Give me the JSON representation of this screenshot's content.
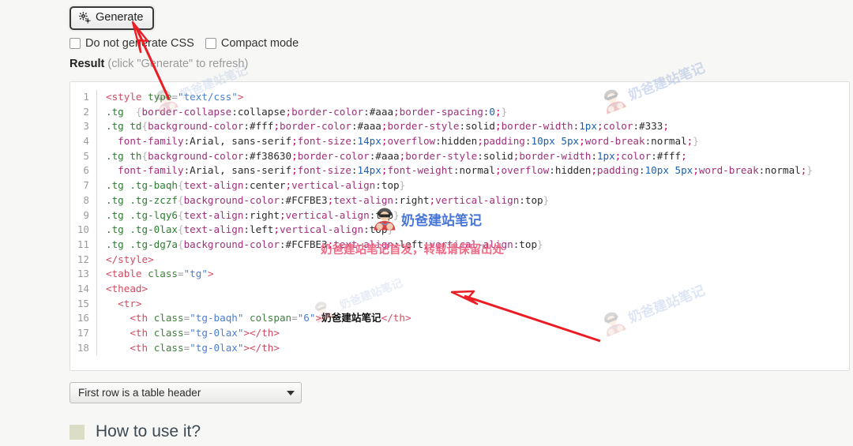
{
  "toolbar": {
    "generate_label": "Generate",
    "generate_icon": "gear-icon"
  },
  "options": {
    "no_css_label": "Do not generate CSS",
    "no_css_checked": false,
    "compact_label": "Compact mode",
    "compact_checked": false
  },
  "result": {
    "label": "Result",
    "hint": "(click \"Generate\" to refresh)"
  },
  "select": {
    "value": "First row is a table header",
    "caret_icon": "chevron-down-icon"
  },
  "howto": {
    "title": "How to use it?"
  },
  "code": {
    "lines": [
      {
        "n": "1",
        "tokens": [
          {
            "c": "t-tag",
            "s": "<style "
          },
          {
            "c": "t-attr",
            "s": "type"
          },
          {
            "c": "t-punct",
            "s": "="
          },
          {
            "c": "t-str",
            "s": "\"text/css\""
          },
          {
            "c": "t-tag",
            "s": ">"
          }
        ]
      },
      {
        "n": "2",
        "tokens": [
          {
            "c": "t-sel",
            "s": ".tg  "
          },
          {
            "c": "t-brace",
            "s": "{"
          },
          {
            "c": "t-prop",
            "s": "border-collapse"
          },
          {
            "c": "t-plain",
            "s": ":"
          },
          {
            "c": "t-val",
            "s": "collapse"
          },
          {
            "c": "t-semi",
            "s": ";"
          },
          {
            "c": "t-prop",
            "s": "border-color"
          },
          {
            "c": "t-plain",
            "s": ":"
          },
          {
            "c": "t-val",
            "s": "#aaa"
          },
          {
            "c": "t-semi",
            "s": ";"
          },
          {
            "c": "t-prop",
            "s": "border-spacing"
          },
          {
            "c": "t-plain",
            "s": ":"
          },
          {
            "c": "t-num",
            "s": "0"
          },
          {
            "c": "t-semi",
            "s": ";"
          },
          {
            "c": "t-brace",
            "s": "}"
          }
        ]
      },
      {
        "n": "3",
        "tokens": [
          {
            "c": "t-sel",
            "s": ".tg td"
          },
          {
            "c": "t-brace",
            "s": "{"
          },
          {
            "c": "t-prop",
            "s": "background-color"
          },
          {
            "c": "t-plain",
            "s": ":"
          },
          {
            "c": "t-val",
            "s": "#fff"
          },
          {
            "c": "t-semi",
            "s": ";"
          },
          {
            "c": "t-prop",
            "s": "border-color"
          },
          {
            "c": "t-plain",
            "s": ":"
          },
          {
            "c": "t-val",
            "s": "#aaa"
          },
          {
            "c": "t-semi",
            "s": ";"
          },
          {
            "c": "t-prop",
            "s": "border-style"
          },
          {
            "c": "t-plain",
            "s": ":"
          },
          {
            "c": "t-val",
            "s": "solid"
          },
          {
            "c": "t-semi",
            "s": ";"
          },
          {
            "c": "t-prop",
            "s": "border-width"
          },
          {
            "c": "t-plain",
            "s": ":"
          },
          {
            "c": "t-num",
            "s": "1px"
          },
          {
            "c": "t-semi",
            "s": ";"
          },
          {
            "c": "t-prop",
            "s": "color"
          },
          {
            "c": "t-plain",
            "s": ":"
          },
          {
            "c": "t-val",
            "s": "#333"
          },
          {
            "c": "t-semi",
            "s": ";"
          }
        ]
      },
      {
        "n": "4",
        "tokens": [
          {
            "c": "t-plain",
            "s": "  "
          },
          {
            "c": "t-prop",
            "s": "font-family"
          },
          {
            "c": "t-plain",
            "s": ":"
          },
          {
            "c": "t-val",
            "s": "Arial, sans-serif"
          },
          {
            "c": "t-semi",
            "s": ";"
          },
          {
            "c": "t-prop",
            "s": "font-size"
          },
          {
            "c": "t-plain",
            "s": ":"
          },
          {
            "c": "t-num",
            "s": "14px"
          },
          {
            "c": "t-semi",
            "s": ";"
          },
          {
            "c": "t-prop",
            "s": "overflow"
          },
          {
            "c": "t-plain",
            "s": ":"
          },
          {
            "c": "t-val",
            "s": "hidden"
          },
          {
            "c": "t-semi",
            "s": ";"
          },
          {
            "c": "t-prop",
            "s": "padding"
          },
          {
            "c": "t-plain",
            "s": ":"
          },
          {
            "c": "t-num",
            "s": "10px 5px"
          },
          {
            "c": "t-semi",
            "s": ";"
          },
          {
            "c": "t-prop",
            "s": "word-break"
          },
          {
            "c": "t-plain",
            "s": ":"
          },
          {
            "c": "t-val",
            "s": "normal"
          },
          {
            "c": "t-semi",
            "s": ";"
          },
          {
            "c": "t-brace",
            "s": "}"
          }
        ]
      },
      {
        "n": "5",
        "tokens": [
          {
            "c": "t-sel",
            "s": ".tg th"
          },
          {
            "c": "t-brace",
            "s": "{"
          },
          {
            "c": "t-prop",
            "s": "background-color"
          },
          {
            "c": "t-plain",
            "s": ":"
          },
          {
            "c": "t-val",
            "s": "#f38630"
          },
          {
            "c": "t-semi",
            "s": ";"
          },
          {
            "c": "t-prop",
            "s": "border-color"
          },
          {
            "c": "t-plain",
            "s": ":"
          },
          {
            "c": "t-val",
            "s": "#aaa"
          },
          {
            "c": "t-semi",
            "s": ";"
          },
          {
            "c": "t-prop",
            "s": "border-style"
          },
          {
            "c": "t-plain",
            "s": ":"
          },
          {
            "c": "t-val",
            "s": "solid"
          },
          {
            "c": "t-semi",
            "s": ";"
          },
          {
            "c": "t-prop",
            "s": "border-width"
          },
          {
            "c": "t-plain",
            "s": ":"
          },
          {
            "c": "t-num",
            "s": "1px"
          },
          {
            "c": "t-semi",
            "s": ";"
          },
          {
            "c": "t-prop",
            "s": "color"
          },
          {
            "c": "t-plain",
            "s": ":"
          },
          {
            "c": "t-val",
            "s": "#fff"
          },
          {
            "c": "t-semi",
            "s": ";"
          }
        ]
      },
      {
        "n": "6",
        "tokens": [
          {
            "c": "t-plain",
            "s": "  "
          },
          {
            "c": "t-prop",
            "s": "font-family"
          },
          {
            "c": "t-plain",
            "s": ":"
          },
          {
            "c": "t-val",
            "s": "Arial, sans-serif"
          },
          {
            "c": "t-semi",
            "s": ";"
          },
          {
            "c": "t-prop",
            "s": "font-size"
          },
          {
            "c": "t-plain",
            "s": ":"
          },
          {
            "c": "t-num",
            "s": "14px"
          },
          {
            "c": "t-semi",
            "s": ";"
          },
          {
            "c": "t-prop",
            "s": "font-weight"
          },
          {
            "c": "t-plain",
            "s": ":"
          },
          {
            "c": "t-val",
            "s": "normal"
          },
          {
            "c": "t-semi",
            "s": ";"
          },
          {
            "c": "t-prop",
            "s": "overflow"
          },
          {
            "c": "t-plain",
            "s": ":"
          },
          {
            "c": "t-val",
            "s": "hidden"
          },
          {
            "c": "t-semi",
            "s": ";"
          },
          {
            "c": "t-prop",
            "s": "padding"
          },
          {
            "c": "t-plain",
            "s": ":"
          },
          {
            "c": "t-num",
            "s": "10px 5px"
          },
          {
            "c": "t-semi",
            "s": ";"
          },
          {
            "c": "t-prop",
            "s": "word-break"
          },
          {
            "c": "t-plain",
            "s": ":"
          },
          {
            "c": "t-val",
            "s": "normal"
          },
          {
            "c": "t-semi",
            "s": ";"
          },
          {
            "c": "t-brace",
            "s": "}"
          }
        ]
      },
      {
        "n": "7",
        "tokens": [
          {
            "c": "t-sel",
            "s": ".tg .tg-baqh"
          },
          {
            "c": "t-brace",
            "s": "{"
          },
          {
            "c": "t-prop",
            "s": "text-align"
          },
          {
            "c": "t-plain",
            "s": ":"
          },
          {
            "c": "t-val",
            "s": "center"
          },
          {
            "c": "t-semi",
            "s": ";"
          },
          {
            "c": "t-prop",
            "s": "vertical-align"
          },
          {
            "c": "t-plain",
            "s": ":"
          },
          {
            "c": "t-val",
            "s": "top"
          },
          {
            "c": "t-brace",
            "s": "}"
          }
        ]
      },
      {
        "n": "8",
        "tokens": [
          {
            "c": "t-sel",
            "s": ".tg .tg-zczf"
          },
          {
            "c": "t-brace",
            "s": "{"
          },
          {
            "c": "t-prop",
            "s": "background-color"
          },
          {
            "c": "t-plain",
            "s": ":"
          },
          {
            "c": "t-val",
            "s": "#FCFBE3"
          },
          {
            "c": "t-semi",
            "s": ";"
          },
          {
            "c": "t-prop",
            "s": "text-align"
          },
          {
            "c": "t-plain",
            "s": ":"
          },
          {
            "c": "t-val",
            "s": "right"
          },
          {
            "c": "t-semi",
            "s": ";"
          },
          {
            "c": "t-prop",
            "s": "vertical-align"
          },
          {
            "c": "t-plain",
            "s": ":"
          },
          {
            "c": "t-val",
            "s": "top"
          },
          {
            "c": "t-brace",
            "s": "}"
          }
        ]
      },
      {
        "n": "9",
        "tokens": [
          {
            "c": "t-sel",
            "s": ".tg .tg-lqy6"
          },
          {
            "c": "t-brace",
            "s": "{"
          },
          {
            "c": "t-prop",
            "s": "text-align"
          },
          {
            "c": "t-plain",
            "s": ":"
          },
          {
            "c": "t-val",
            "s": "right"
          },
          {
            "c": "t-semi",
            "s": ";"
          },
          {
            "c": "t-prop",
            "s": "vertical-align"
          },
          {
            "c": "t-plain",
            "s": ":"
          },
          {
            "c": "t-val",
            "s": "top"
          },
          {
            "c": "t-brace",
            "s": "}"
          }
        ]
      },
      {
        "n": "10",
        "tokens": [
          {
            "c": "t-sel",
            "s": ".tg .tg-0lax"
          },
          {
            "c": "t-brace",
            "s": "{"
          },
          {
            "c": "t-prop",
            "s": "text-align"
          },
          {
            "c": "t-plain",
            "s": ":"
          },
          {
            "c": "t-val",
            "s": "left"
          },
          {
            "c": "t-semi",
            "s": ";"
          },
          {
            "c": "t-prop",
            "s": "vertical-align"
          },
          {
            "c": "t-plain",
            "s": ":"
          },
          {
            "c": "t-val",
            "s": "top"
          },
          {
            "c": "t-brace",
            "s": "}"
          }
        ]
      },
      {
        "n": "11",
        "tokens": [
          {
            "c": "t-sel",
            "s": ".tg .tg-dg7a"
          },
          {
            "c": "t-brace",
            "s": "{"
          },
          {
            "c": "t-prop",
            "s": "background-color"
          },
          {
            "c": "t-plain",
            "s": ":"
          },
          {
            "c": "t-val",
            "s": "#FCFBE3"
          },
          {
            "c": "t-semi",
            "s": ";"
          },
          {
            "c": "t-prop",
            "s": "text-align"
          },
          {
            "c": "t-plain",
            "s": ":"
          },
          {
            "c": "t-val",
            "s": "left"
          },
          {
            "c": "t-semi",
            "s": ";"
          },
          {
            "c": "t-prop",
            "s": "vertical-align"
          },
          {
            "c": "t-plain",
            "s": ":"
          },
          {
            "c": "t-val",
            "s": "top"
          },
          {
            "c": "t-brace",
            "s": "}"
          }
        ]
      },
      {
        "n": "12",
        "tokens": [
          {
            "c": "t-tag",
            "s": "</style>"
          }
        ]
      },
      {
        "n": "13",
        "tokens": [
          {
            "c": "t-tag",
            "s": "<table "
          },
          {
            "c": "t-attr",
            "s": "class"
          },
          {
            "c": "t-punct",
            "s": "="
          },
          {
            "c": "t-str",
            "s": "\"tg\""
          },
          {
            "c": "t-tag",
            "s": ">"
          }
        ]
      },
      {
        "n": "14",
        "tokens": [
          {
            "c": "t-tag",
            "s": "<thead>"
          }
        ]
      },
      {
        "n": "15",
        "tokens": [
          {
            "c": "t-plain",
            "s": "  "
          },
          {
            "c": "t-tag",
            "s": "<tr>"
          }
        ]
      },
      {
        "n": "16",
        "tokens": [
          {
            "c": "t-plain",
            "s": "    "
          },
          {
            "c": "t-tag",
            "s": "<th "
          },
          {
            "c": "t-attr",
            "s": "class"
          },
          {
            "c": "t-punct",
            "s": "="
          },
          {
            "c": "t-str",
            "s": "\"tg-baqh\""
          },
          {
            "c": "t-plain",
            "s": " "
          },
          {
            "c": "t-attr",
            "s": "colspan"
          },
          {
            "c": "t-punct",
            "s": "="
          },
          {
            "c": "t-str",
            "s": "\"6\""
          },
          {
            "c": "t-tag",
            "s": ">"
          },
          {
            "c": "t-cn",
            "s": "奶爸建站笔记"
          },
          {
            "c": "t-tag",
            "s": "</th>"
          }
        ]
      },
      {
        "n": "17",
        "tokens": [
          {
            "c": "t-plain",
            "s": "    "
          },
          {
            "c": "t-tag",
            "s": "<th "
          },
          {
            "c": "t-attr",
            "s": "class"
          },
          {
            "c": "t-punct",
            "s": "="
          },
          {
            "c": "t-str",
            "s": "\"tg-0lax\""
          },
          {
            "c": "t-tag",
            "s": "></th>"
          }
        ]
      },
      {
        "n": "18",
        "tokens": [
          {
            "c": "t-plain",
            "s": "    "
          },
          {
            "c": "t-tag",
            "s": "<th "
          },
          {
            "c": "t-attr",
            "s": "class"
          },
          {
            "c": "t-punct",
            "s": "="
          },
          {
            "c": "t-str",
            "s": "\"tg-0lax\""
          },
          {
            "c": "t-tag",
            "s": "></th>"
          }
        ]
      }
    ]
  },
  "watermarks": {
    "brand_text": "奶爸建站笔记",
    "notice_text": "奶爸建站笔记首发，转载请保留出处",
    "avatar_icon": "avatar-icon"
  },
  "annotations": {
    "arrow_1_name": "red-arrow-to-generate-button",
    "arrow_2_name": "red-arrow-to-code-area",
    "arrow_color": "#ec1c24"
  }
}
